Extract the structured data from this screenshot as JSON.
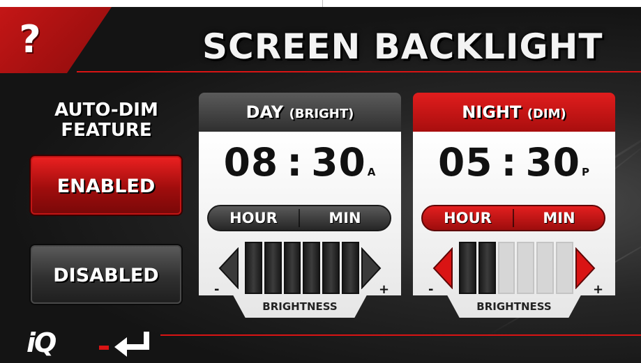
{
  "title": "SCREEN BACKLIGHT",
  "help_label": "?",
  "auto_dim": {
    "heading_line1": "AUTO-DIM",
    "heading_line2": "FEATURE",
    "enabled_label": "ENABLED",
    "disabled_label": "DISABLED",
    "selected": "ENABLED"
  },
  "day": {
    "title": "DAY",
    "subtitle": "(BRIGHT)",
    "hour": "08",
    "separator": ":",
    "minute": "30",
    "ampm": "A",
    "hour_label": "HOUR",
    "min_label": "MIN",
    "brightness_label": "BRIGHTNESS",
    "brightness_level": 6,
    "brightness_max": 6,
    "minus": "-",
    "plus": "+"
  },
  "night": {
    "title": "NIGHT",
    "subtitle": "(DIM)",
    "hour": "05",
    "separator": ":",
    "minute": "30",
    "ampm": "P",
    "hour_label": "HOUR",
    "min_label": "MIN",
    "brightness_label": "BRIGHTNESS",
    "brightness_level": 2,
    "brightness_max": 6,
    "minus": "-",
    "plus": "+"
  },
  "footer": {
    "logo": "iQ",
    "back_icon": "return-arrow-icon"
  },
  "colors": {
    "accent_red": "#d91414",
    "button_dark": "#303030",
    "background": "#1a1a1a"
  }
}
